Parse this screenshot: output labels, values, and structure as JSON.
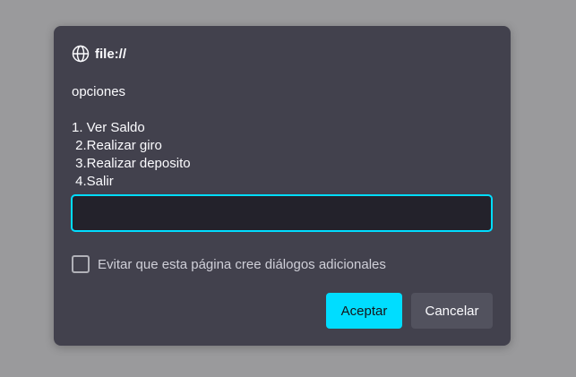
{
  "dialog": {
    "origin": "file://",
    "message": "opciones\n\n1. Ver Saldo\n 2.Realizar giro\n 3.Realizar deposito\n 4.Salir",
    "input_value": "",
    "checkbox_label": "Evitar que esta página cree diálogos adicionales",
    "checkbox_checked": false,
    "accept_label": "Aceptar",
    "cancel_label": "Cancelar"
  },
  "colors": {
    "backdrop": "#9a9a9c",
    "dialog_bg": "#42414d",
    "accent": "#00ddff",
    "input_bg": "#23222b"
  },
  "icons": {
    "origin": "globe-icon"
  }
}
